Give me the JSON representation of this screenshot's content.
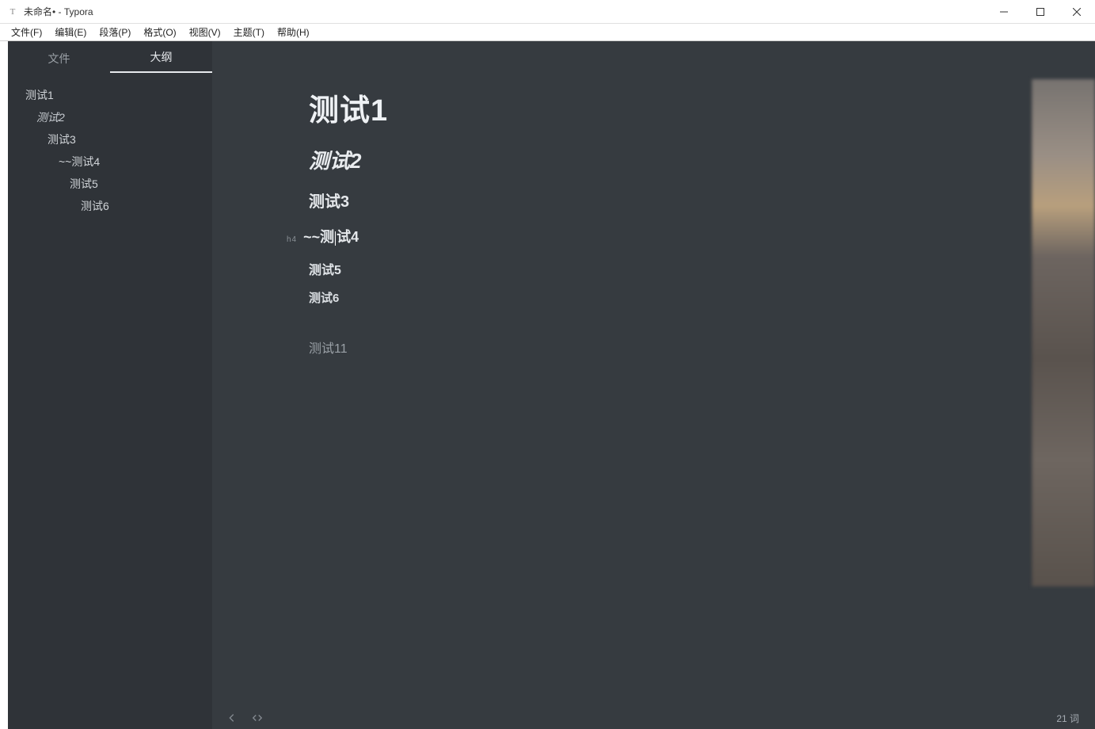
{
  "window": {
    "title": "未命名• - Typora",
    "icon_label": "T"
  },
  "menu": {
    "file": "文件(F)",
    "edit": "编辑(E)",
    "paragraph": "段落(P)",
    "format": "格式(O)",
    "view": "视图(V)",
    "theme": "主题(T)",
    "help": "帮助(H)"
  },
  "sidebar": {
    "tabs": {
      "files": "文件",
      "outline": "大纲"
    },
    "outline": [
      {
        "label": "测试1",
        "level": 1
      },
      {
        "label": "测试2",
        "level": 2
      },
      {
        "label": "测试3",
        "level": 3
      },
      {
        "label": "~~测试4",
        "level": 4
      },
      {
        "label": "测试5",
        "level": 5
      },
      {
        "label": "测试6",
        "level": 6
      }
    ]
  },
  "document": {
    "h1": "测试1",
    "h2": "测试2",
    "h3": "测试3",
    "h4_hint": "h4",
    "h4": "~~测试4",
    "h5": "测试5",
    "h6": "测试6",
    "para": "测试11"
  },
  "status": {
    "word_count": "21 词"
  }
}
